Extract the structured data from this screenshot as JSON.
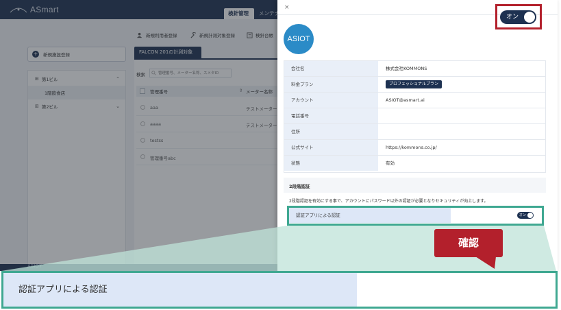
{
  "app": {
    "logo_text": "ASmart",
    "tabs": {
      "measure": "検針管理",
      "maint": "メンテナ"
    },
    "new_facility_label": "新規施設登録",
    "tree": {
      "building1": "第1ビル",
      "shop": "1階飲食店",
      "building2": "第2ビル"
    },
    "actions": {
      "new_user": "新規利用者登録",
      "new_target": "新規計測対象登録",
      "ledger": "検針台帳"
    },
    "falcon_tab": "FALCON 201の計測対象",
    "search": {
      "label": "検索",
      "placeholder": "管理番号、メーター名称、スメタID"
    },
    "table": {
      "col_id": "管理番号",
      "col_maker": "メーター名称",
      "rows": [
        {
          "id": "aaa",
          "maker": "テストメーター"
        },
        {
          "id": "aaaa",
          "maker": "テストメーター"
        },
        {
          "id": "testss",
          "maker": ""
        },
        {
          "id": "管理番号abc",
          "maker": ""
        }
      ]
    },
    "footer_text": "ASIOT"
  },
  "drawer": {
    "close": "×",
    "logo": "ASIOT",
    "info": [
      {
        "label": "会社名",
        "value": "株式会社KOMMONS"
      },
      {
        "label": "料金プラン",
        "value": ""
      },
      {
        "label": "アカウント",
        "value": "ASIOT@asmart.ai"
      },
      {
        "label": "電話番号",
        "value": ""
      },
      {
        "label": "住所",
        "value": ""
      },
      {
        "label": "公式サイト",
        "value": "https://kommons.co.jp/"
      },
      {
        "label": "状態",
        "value": "有効"
      }
    ],
    "plan_badge": "プロフェッショナルプラン",
    "twofa_title": "2段階認証",
    "twofa_desc": "2段階認証を有効にする事で、アカウントにパスワード以外の認証が必要となりセキュリティが向上します。",
    "auth_app_label": "認証アプリによる認証",
    "toggle_label": "オン"
  },
  "zoom": {
    "label": "認証アプリによる認証",
    "toggle_label": "オン"
  },
  "callout": {
    "text": "確認"
  },
  "colors": {
    "navy": "#1d3151",
    "teal": "#3fa891",
    "red": "#b3202c",
    "label_bg": "#dde7f7"
  }
}
